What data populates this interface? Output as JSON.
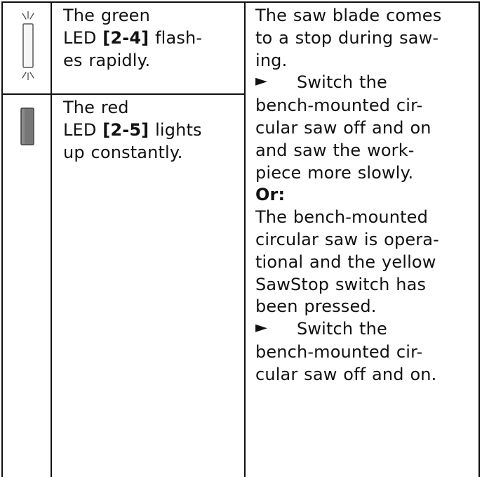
{
  "table": {
    "rows": [
      {
        "indicator": {
          "icon": "flashing-led-icon",
          "color": "#ffffff"
        },
        "lines": [
          [
            {
              "text": "The green"
            }
          ],
          [
            {
              "text": "LED "
            },
            {
              "text": "[2-4]",
              "bold": true
            },
            {
              "text": " flash-"
            }
          ],
          [
            {
              "text": "es rapidly."
            }
          ]
        ]
      },
      {
        "indicator": {
          "icon": "steady-led-icon",
          "color": "#777777"
        },
        "lines": [
          [
            {
              "text": "The red"
            }
          ],
          [
            {
              "text": "LED "
            },
            {
              "text": "[2-5]",
              "bold": true
            },
            {
              "text": " lights"
            }
          ],
          [
            {
              "text": "up constantly."
            }
          ]
        ]
      }
    ],
    "remedy": {
      "lines": [
        {
          "kind": "text",
          "text": "The saw blade comes"
        },
        {
          "kind": "text",
          "text": "to a stop during saw-"
        },
        {
          "kind": "text",
          "text": "ing."
        },
        {
          "kind": "action",
          "text": "Switch the"
        },
        {
          "kind": "text",
          "text": "bench-mounted cir-"
        },
        {
          "kind": "text",
          "text": "cular saw off and on"
        },
        {
          "kind": "text",
          "text": "and saw the work-"
        },
        {
          "kind": "text",
          "text": "piece more slowly."
        },
        {
          "kind": "bold",
          "text": "Or:"
        },
        {
          "kind": "text",
          "text": "The bench-mounted"
        },
        {
          "kind": "text",
          "text": "circular saw is opera-"
        },
        {
          "kind": "text",
          "text": "tional and the yellow"
        },
        {
          "kind": "text",
          "text": "SawStop switch has"
        },
        {
          "kind": "text",
          "text": "been pressed."
        },
        {
          "kind": "action",
          "text": "Switch the"
        },
        {
          "kind": "text",
          "text": "bench-mounted cir-"
        },
        {
          "kind": "text",
          "text": "cular saw off and on."
        }
      ],
      "action_marker_icon": "arrow-marker-icon"
    }
  }
}
